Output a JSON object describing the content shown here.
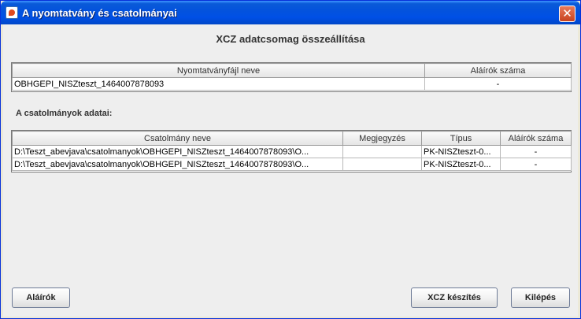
{
  "window": {
    "title": "A nyomtatvány és csatolmányai",
    "close_glyph": "✕"
  },
  "heading": "XCZ adatcsomag összeállítása",
  "form_table": {
    "headers": [
      "Nyomtatványfájl neve",
      "Aláírók száma"
    ],
    "rows": [
      [
        "OBHGEPI_NISZteszt_1464007878093",
        "-"
      ]
    ]
  },
  "attachments": {
    "label": "A csatolmányok adatai:",
    "headers": [
      "Csatolmány neve",
      "Megjegyzés",
      "Típus",
      "Aláírók száma"
    ],
    "rows": [
      [
        "D:\\Teszt_abevjava\\csatolmanyok\\OBHGEPI_NISZteszt_1464007878093\\O...",
        "",
        "PK-NISZteszt-0...",
        "-"
      ],
      [
        "D:\\Teszt_abevjava\\csatolmanyok\\OBHGEPI_NISZteszt_1464007878093\\O...",
        "",
        "PK-NISZteszt-0...",
        "-"
      ]
    ]
  },
  "buttons": {
    "signers": "Aláírók",
    "create_xcz": "XCZ készítés",
    "exit": "Kilépés"
  }
}
